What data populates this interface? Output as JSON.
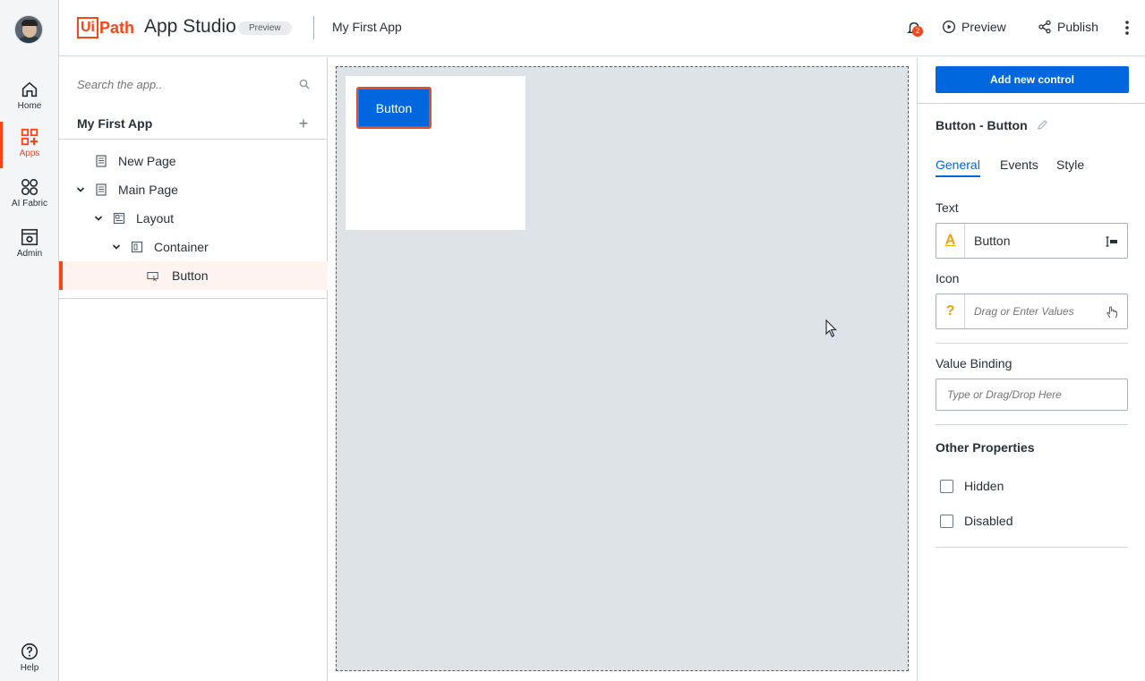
{
  "nav": {
    "items": [
      {
        "label": "Home",
        "icon": "home-icon"
      },
      {
        "label": "Apps",
        "icon": "apps-icon"
      },
      {
        "label": "AI Fabric",
        "icon": "ai-fabric-icon"
      },
      {
        "label": "Admin",
        "icon": "admin-icon"
      }
    ],
    "help_label": "Help"
  },
  "header": {
    "logo_ui": "Ui",
    "logo_path": "Path",
    "product": "App Studio",
    "badge": "Preview",
    "app_title": "My First App",
    "notification_count": "2",
    "preview_label": "Preview",
    "publish_label": "Publish"
  },
  "tree": {
    "search_placeholder": "Search the app..",
    "title": "My First App",
    "nodes": [
      {
        "label": "New Page",
        "icon": "page-icon"
      },
      {
        "label": "Main Page",
        "icon": "page-icon"
      },
      {
        "label": "Layout",
        "icon": "layout-icon"
      },
      {
        "label": "Container",
        "icon": "container-icon"
      },
      {
        "label": "Button",
        "icon": "button-control-icon"
      }
    ]
  },
  "canvas": {
    "button_label": "Button"
  },
  "props": {
    "add_control_label": "Add new control",
    "control_title": "Button - Button",
    "tabs": [
      "General",
      "Events",
      "Style"
    ],
    "text_label": "Text",
    "text_value": "Button",
    "icon_label": "Icon",
    "icon_placeholder": "Drag or Enter Values",
    "value_binding_label": "Value Binding",
    "value_binding_placeholder": "Type or Drag/Drop Here",
    "other_properties": "Other Properties",
    "hidden_label": "Hidden",
    "disabled_label": "Disabled"
  },
  "colors": {
    "brand": "#fa4616",
    "primary": "#0067df",
    "canvas_bg": "#dde3e7"
  }
}
